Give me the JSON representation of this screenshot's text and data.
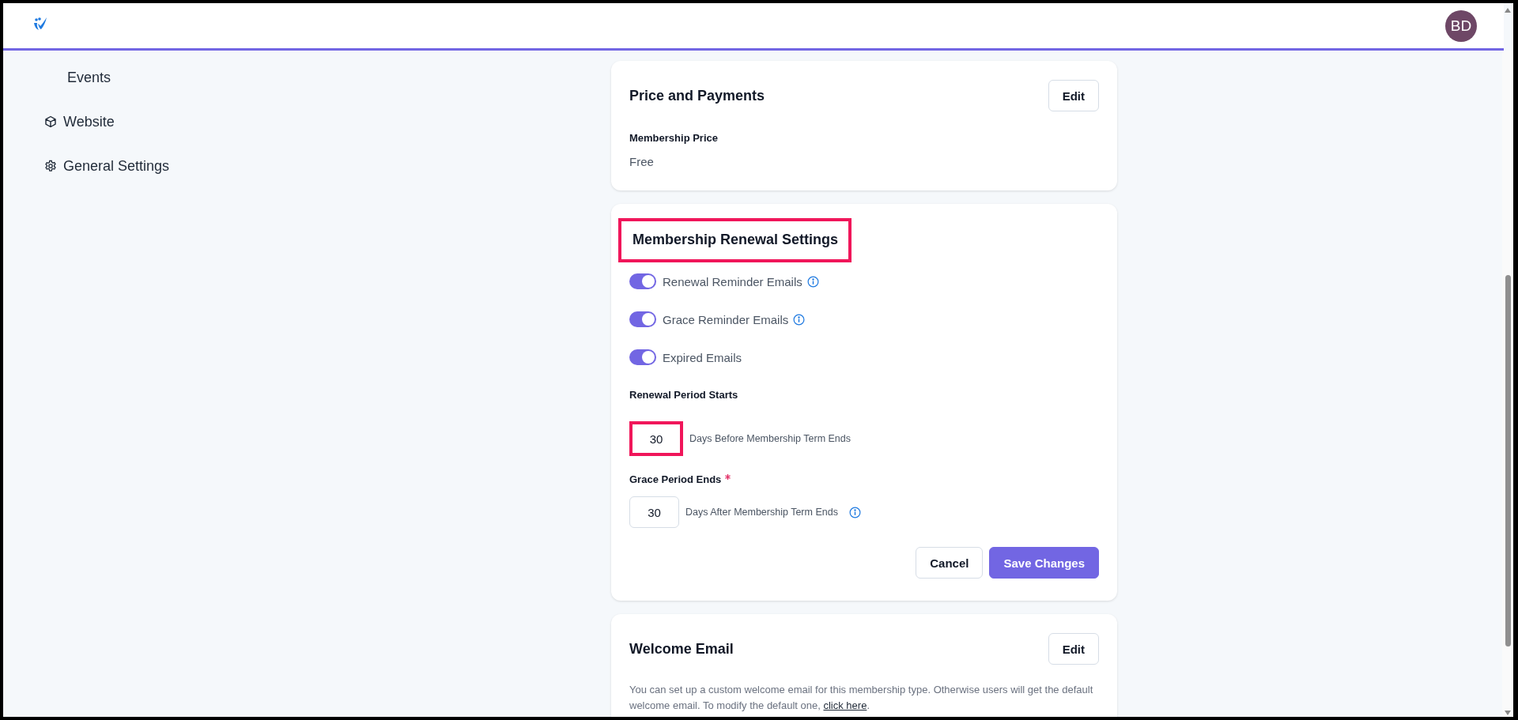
{
  "header": {
    "avatar_initials": "BD"
  },
  "sidebar": {
    "items": [
      {
        "label": "Events"
      },
      {
        "label": "Website"
      },
      {
        "label": "General Settings"
      }
    ]
  },
  "price_card": {
    "title": "Price and Payments",
    "edit_button": "Edit",
    "field_label": "Membership Price",
    "field_value": "Free"
  },
  "renewal_card": {
    "title": "Membership Renewal Settings",
    "title_highlighted": true,
    "toggles": [
      {
        "label": "Renewal Reminder Emails",
        "on": true,
        "info_icon": true
      },
      {
        "label": "Grace Reminder Emails",
        "on": true,
        "info_icon": true
      },
      {
        "label": "Expired Emails",
        "on": true,
        "info_icon": false
      }
    ],
    "periods": [
      {
        "label": "Renewal Period Starts",
        "required": false,
        "value": "30",
        "suffix": "Days Before Membership Term Ends",
        "info_icon": false,
        "highlighted": true
      },
      {
        "label": "Grace Period Ends",
        "required": true,
        "value": "30",
        "suffix": "Days After Membership Term Ends",
        "info_icon": true,
        "highlighted": false
      }
    ],
    "cancel_button": "Cancel",
    "save_button": "Save Changes"
  },
  "welcome_card": {
    "title": "Welcome Email",
    "edit_button": "Edit",
    "description": "You can set up a custom welcome email for this membership type. Otherwise users will get the default welcome email. To modify the default one,",
    "link": "click here",
    "trailing": "."
  }
}
